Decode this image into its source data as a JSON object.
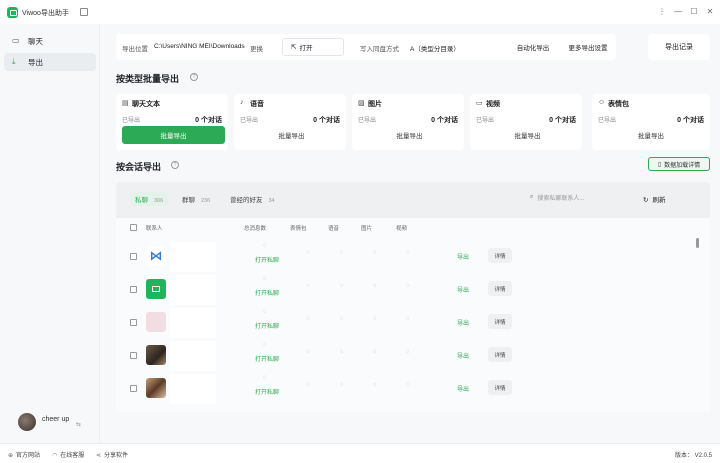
{
  "app": {
    "title": "Viwoo导出助手"
  },
  "window": {
    "menu": "⋮",
    "minimize": "—",
    "maximize": "☐",
    "close": "✕"
  },
  "sidebar": {
    "items": [
      {
        "label": "聊天",
        "icon": "chat-icon"
      },
      {
        "label": "导出",
        "icon": "export-icon",
        "active": true
      }
    ],
    "user": {
      "name": "cheer up"
    }
  },
  "toolbar": {
    "location_label": "导出位置",
    "location_value": "C:\\Users\\NING MEI\\Downloads",
    "browse_label": "更换",
    "open_label": "打开",
    "write_mode_label": "写入同盘方式",
    "write_mode_value": "A（类型分目录）",
    "auto_export_label": "自动化导出",
    "more_settings_label": "更多导出设置",
    "records_label": "导出记录"
  },
  "batch": {
    "title": "按类型批量导出",
    "cards": [
      {
        "label": "聊天文本",
        "icon": "chat-text-icon",
        "exported": "已导出",
        "count": "0 个对话",
        "button": "批量导出",
        "primary": true
      },
      {
        "label": "语音",
        "icon": "microphone-icon",
        "exported": "已导出",
        "count": "0 个对话",
        "button": "批量导出"
      },
      {
        "label": "图片",
        "icon": "image-icon",
        "exported": "已导出",
        "count": "0 个对话",
        "button": "批量导出"
      },
      {
        "label": "视频",
        "icon": "video-icon",
        "exported": "已导出",
        "count": "0 个对话",
        "button": "批量导出"
      },
      {
        "label": "表情包",
        "icon": "emoji-icon",
        "exported": "已导出",
        "count": "0 个对话",
        "button": "批量导出"
      }
    ]
  },
  "session": {
    "title": "按会话导出",
    "load_detail_label": "数据加载详情",
    "tabs": [
      {
        "label": "私聊",
        "count": "306",
        "active": true
      },
      {
        "label": "群聊",
        "count": "236"
      },
      {
        "label": "曾经的好友",
        "count": "34"
      }
    ],
    "search_placeholder": "搜索私聊联系人...",
    "refresh_label": "刷新",
    "columns": [
      "联系人",
      "总消息数",
      "表情包",
      "语音",
      "图片",
      "视频"
    ],
    "rows": [
      {
        "avatar": "logo-blue",
        "open_label": "打开私聊",
        "export_label": "导出",
        "detail_label": "详情"
      },
      {
        "avatar": "logo-green",
        "open_label": "打开私聊",
        "export_label": "导出",
        "detail_label": "详情"
      },
      {
        "avatar": "pink",
        "open_label": "打开私聊",
        "export_label": "导出",
        "detail_label": "详情"
      },
      {
        "avatar": "photo",
        "open_label": "打开私聊",
        "export_label": "导出",
        "detail_label": "详情"
      },
      {
        "avatar": "photo2",
        "open_label": "打开私聊",
        "export_label": "导出",
        "detail_label": "详情"
      }
    ]
  },
  "footer": {
    "website": "官方网站",
    "support": "在线客服",
    "share": "分享软件",
    "version": "版本： V2.0.5"
  },
  "colors": {
    "accent": "#2daa55",
    "background": "#f7f8f9"
  }
}
